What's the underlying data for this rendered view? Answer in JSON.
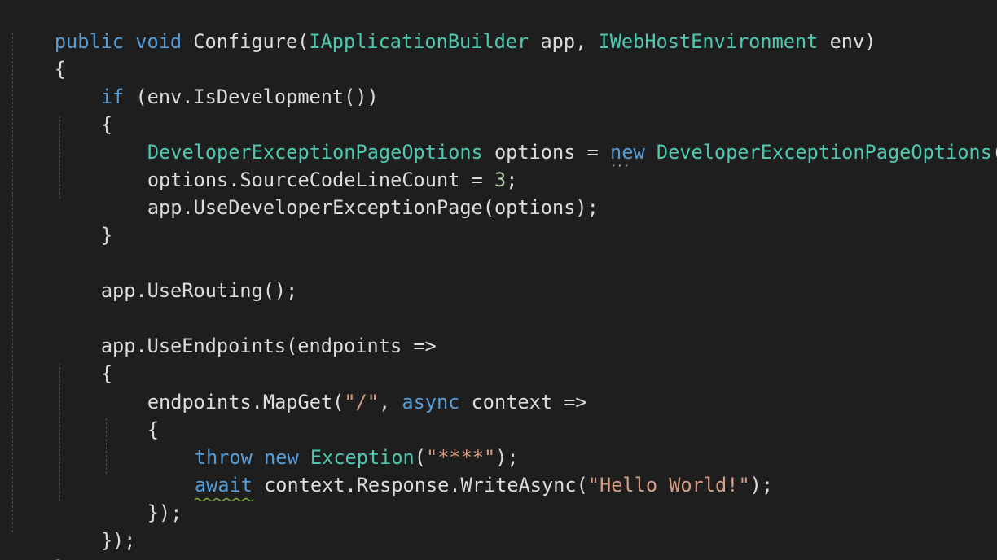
{
  "editor": {
    "theme": {
      "background": "#1e1e1e",
      "keyword": "#569cd6",
      "type": "#4ec9b0",
      "string": "#d69d85",
      "number": "#b5cea8",
      "text": "#dcdcdc",
      "squiggle": "#7fb343"
    },
    "line1": [
      "public",
      " ",
      "void",
      " Configure(",
      "IApplicationBuilder",
      " app, ",
      "IWebHostEnvironment",
      " env)"
    ],
    "line2": [
      "{"
    ],
    "line3": [
      "if",
      " (env.IsDevelopment())"
    ],
    "line4": [
      "{"
    ],
    "line5": [
      "DeveloperExceptionPageOptions",
      " options = ",
      "new",
      " ",
      "DeveloperExceptionPageOptions",
      "();"
    ],
    "line6": [
      "options.SourceCodeLineCount = ",
      "3",
      ";"
    ],
    "line7": [
      "app.UseDeveloperExceptionPage(options);"
    ],
    "line8": [
      "}"
    ],
    "line10": [
      "app.UseRouting();"
    ],
    "line12": [
      "app.UseEndpoints(endpoints =>"
    ],
    "line13": [
      "{"
    ],
    "line14": [
      "endpoints.MapGet(",
      "\"/\"",
      ", ",
      "async",
      " context =>"
    ],
    "line15": [
      "{"
    ],
    "line16": [
      "throw",
      " ",
      "new",
      " ",
      "Exception",
      "(",
      "\"****\"",
      ");"
    ],
    "line17": [
      "await",
      " context.Response.WriteAsync(",
      "\"Hello World!\"",
      ");"
    ],
    "line18": [
      "});"
    ],
    "line19": [
      "});"
    ],
    "line20": [
      "}"
    ]
  }
}
